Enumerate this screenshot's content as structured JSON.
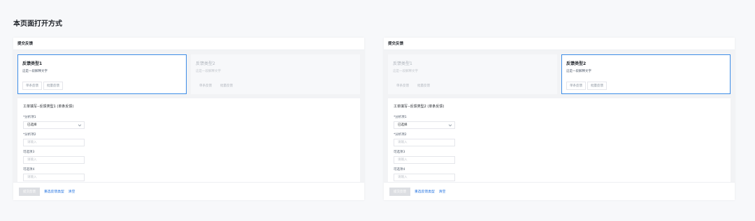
{
  "page": {
    "title": "本页面打开方式"
  },
  "panels": [
    {
      "header": "提交反馈",
      "cards": [
        {
          "title": "反馈类型1",
          "desc": "这是一段解释文字",
          "btn_single": "单条反馈",
          "btn_batch": "批量反馈",
          "active": true
        },
        {
          "title": "反馈类型2",
          "desc": "这是一段解释文字",
          "btn_single": "单条反馈",
          "btn_batch": "批量反馈",
          "active": false
        }
      ],
      "form": {
        "heading": "工单填写--反馈类型1 (单条反馈)",
        "fields": [
          {
            "label": "*分析项1",
            "value": "已选择"
          },
          {
            "label": "*分析项2",
            "placeholder": "请输入"
          },
          {
            "label": "可选项3",
            "placeholder": "请输入"
          },
          {
            "label": "可选项4",
            "placeholder": "请输入"
          }
        ]
      },
      "footer": {
        "submit": "提交反馈",
        "reselect": "重选反馈类型",
        "clear": "清空"
      }
    },
    {
      "header": "提交反馈",
      "cards": [
        {
          "title": "反馈类型1",
          "desc": "这是一段解释文字",
          "btn_single": "单条反馈",
          "btn_batch": "批量反馈",
          "active": false
        },
        {
          "title": "反馈类型2",
          "desc": "这是一段解释文字",
          "btn_single": "单条反馈",
          "btn_batch": "批量反馈",
          "active": true
        }
      ],
      "form": {
        "heading": "工单填写--反馈类型2 (单条反馈)",
        "fields": [
          {
            "label": "*分析项1",
            "value": "已选择"
          },
          {
            "label": "*分析项2",
            "placeholder": "请输入"
          },
          {
            "label": "可选项3",
            "placeholder": "请输入"
          },
          {
            "label": "可选项4",
            "placeholder": "请输入"
          }
        ]
      },
      "footer": {
        "submit": "提交反馈",
        "reselect": "重选反馈类型",
        "clear": "清空"
      }
    }
  ],
  "colors": {
    "accent": "#3c8ce7",
    "link": "#1d6fe0",
    "background": "#f7f8fa"
  }
}
